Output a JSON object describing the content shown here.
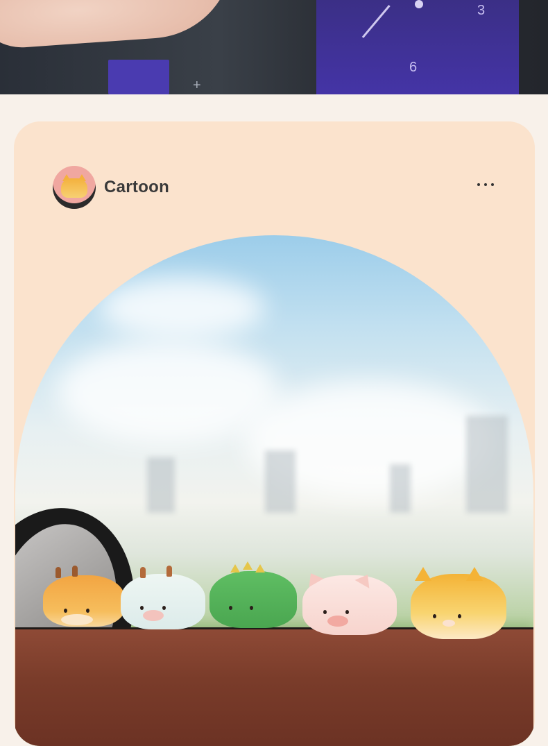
{
  "top_photo": {
    "clock_numbers": [
      "3",
      "6"
    ],
    "colors": {
      "screen": "#4434a6",
      "dash": "#2a2f38"
    }
  },
  "card": {
    "title": "Cartoon",
    "more_icon": "more-horizontal-icon",
    "colors": {
      "background": "#fbe3cd",
      "page": "#f8f1ea"
    }
  },
  "photo": {
    "figurines": [
      "giraffe",
      "cow",
      "dinosaur",
      "pig",
      "cat"
    ]
  }
}
